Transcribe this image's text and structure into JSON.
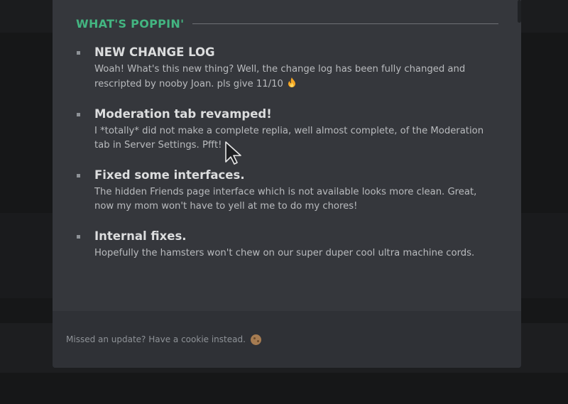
{
  "modal": {
    "section_title": "WHAT'S POPPIN'",
    "entries": [
      {
        "title": "NEW CHANGE LOG",
        "description": "Woah! What's this new thing? Well, the change log has been fully changed and rescripted by nooby Joan. pls give 11/10"
      },
      {
        "title": "Moderation tab revamped!",
        "description": "I *totally* did not make a complete replia, well almost complete, of the Moderation tab in Server Settings. Pfft!"
      },
      {
        "title": "Fixed some interfaces.",
        "description": "The hidden Friends page interface which is not available looks more clean. Great, now my mom won't have to yell at me to do my chores!"
      },
      {
        "title": "Internal fixes.",
        "description": "Hopefully the hamsters won't chew on our super duper cool ultra machine cords."
      }
    ],
    "footer_text": "Missed an update? Have a cookie instead.",
    "icons": {
      "first_entry_icon": "fire-icon",
      "footer_icon": "cookie-icon"
    }
  },
  "colors": {
    "accent": "#43b581",
    "modal_bg": "#35373c",
    "footer_bg": "#2f3136"
  }
}
